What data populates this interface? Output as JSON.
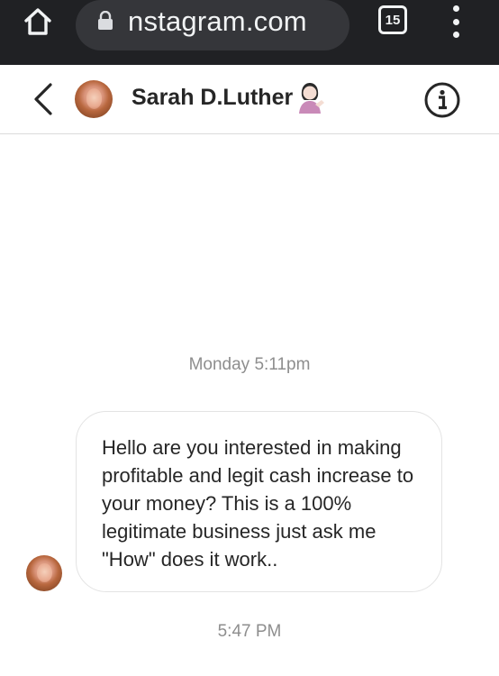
{
  "browser": {
    "url": "nstagram.com",
    "tab_count": "15"
  },
  "header": {
    "contact_name": "Sarah D.Luther",
    "name_emoji": "woman-tipping-hand-emoji"
  },
  "messages": {
    "first_timestamp": "Monday 5:11pm",
    "incoming_text": "Hello are you interested in making profitable and legit cash increase to your money? This is a 100% legitimate business just ask me \"How\" does it work..",
    "second_timestamp": "5:47 PM"
  },
  "colors": {
    "browser_bar": "#202124",
    "omnibox": "#35363a",
    "chat_text": "#262626",
    "timestamp_text": "#8e8e8e",
    "divider": "#dbdbdb"
  },
  "icons": [
    "home-icon",
    "lock-icon",
    "tabs-icon",
    "more-vert-icon",
    "back-arrow-icon",
    "info-icon"
  ]
}
